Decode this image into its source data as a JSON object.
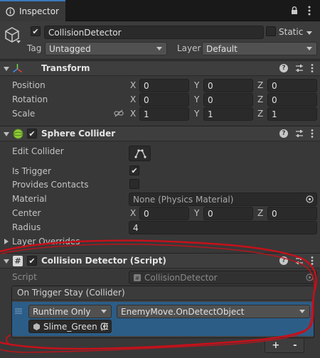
{
  "tab": {
    "label": "Inspector"
  },
  "gameobject": {
    "active": true,
    "name": "CollisionDetector",
    "static_label": "Static",
    "static_checked": false,
    "tag_label": "Tag",
    "tag_value": "Untagged",
    "layer_label": "Layer",
    "layer_value": "Default"
  },
  "transform": {
    "title": "Transform",
    "rows": [
      {
        "label": "Position",
        "x": "0",
        "y": "0",
        "z": "0"
      },
      {
        "label": "Rotation",
        "x": "0",
        "y": "0",
        "z": "0"
      },
      {
        "label": "Scale",
        "x": "1",
        "y": "1",
        "z": "1"
      }
    ],
    "axes": {
      "x": "X",
      "y": "Y",
      "z": "Z"
    }
  },
  "sphere_collider": {
    "title": "Sphere Collider",
    "enabled": true,
    "edit_collider_label": "Edit Collider",
    "is_trigger_label": "Is Trigger",
    "is_trigger": true,
    "provides_contacts_label": "Provides Contacts",
    "provides_contacts": false,
    "material_label": "Material",
    "material_value": "None (Physics Material)",
    "center_label": "Center",
    "center": {
      "x": "0",
      "y": "0",
      "z": "0"
    },
    "radius_label": "Radius",
    "radius_value": "4",
    "layer_overrides_label": "Layer Overrides"
  },
  "script_component": {
    "title": "Collision Detector (Script)",
    "enabled": true,
    "script_label": "Script",
    "script_value": "CollisionDetector",
    "event": {
      "header": "On Trigger Stay (Collider)",
      "runtime_value": "Runtime Only",
      "function_value": "EnemyMove.OnDetectObject",
      "object_value": "Slime_Green (E",
      "add_label": "+",
      "remove_label": "-"
    }
  },
  "colors": {
    "accent": "#3a79bb",
    "annotation_red": "#c8101a",
    "selected_row": "#2c5d87"
  }
}
